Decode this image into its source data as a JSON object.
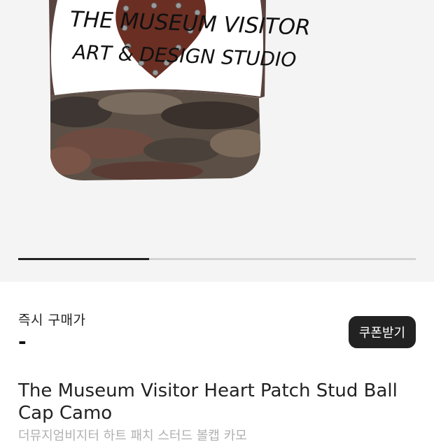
{
  "gallery": {
    "image_alt": "The Museum Visitor Heart Patch Stud Ball Cap Camo",
    "cap_text_line1": "THE MUSEUM VISITOR",
    "cap_text_line2": "ART & DESIGN STUDIO",
    "progress": 0.33
  },
  "price": {
    "label": "즉시 구매가",
    "value": "-"
  },
  "coupon": {
    "label": "쿠폰받기"
  },
  "product": {
    "title": "The Museum Visitor Heart Patch Stud Ball Cap Camo",
    "subtitle": "더뮤지엄비지터 하트 패치 스터드 볼캡 카모"
  }
}
